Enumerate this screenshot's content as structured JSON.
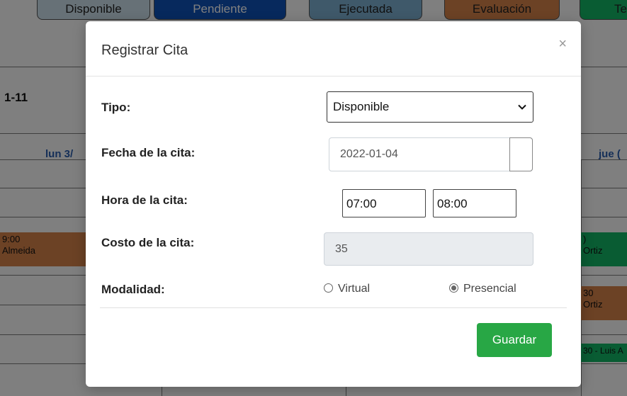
{
  "legend": [
    "Disponible",
    "Pendiente",
    "Ejecutada",
    "Evaluación",
    "Te"
  ],
  "colors": {
    "disponible": "#cfe3ee",
    "pendiente": "#0f52ba",
    "ejecutada": "#7fb3d5",
    "evaluacion": "#d8844b",
    "terminada": "#13b866",
    "save_button": "#28a745"
  },
  "calendar": {
    "title": "1-11",
    "day_left": "lun 3/",
    "day_right": "jue (",
    "events": [
      {
        "time": "9:00",
        "name": "Almeida"
      },
      {
        "time": ")",
        "name": "Ortiz"
      },
      {
        "time": "30",
        "name": "Ortiz"
      },
      {
        "time": "30 - Luis A",
        "name": ""
      }
    ]
  },
  "modal": {
    "title": "Registrar Cita",
    "close": "×",
    "labels": {
      "tipo": "Tipo:",
      "fecha": "Fecha de la cita:",
      "hora": "Hora de la cita:",
      "costo": "Costo de la cita:",
      "modalidad": "Modalidad:"
    },
    "tipo_value": "Disponible",
    "fecha_value": "2022-01-04",
    "hora_inicio": "07:00",
    "hora_fin": "08:00",
    "costo_value": "35",
    "modalidad_options": [
      "Virtual",
      "Presencial"
    ],
    "modalidad_selected": "Presencial",
    "save_label": "Guardar"
  }
}
